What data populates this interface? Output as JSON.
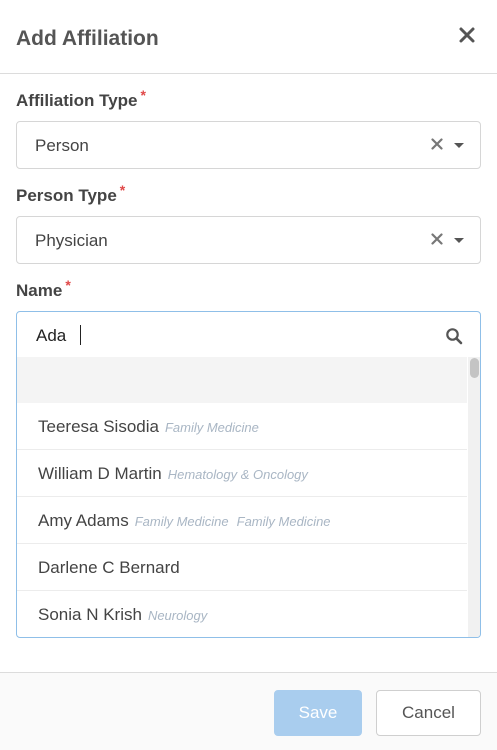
{
  "dialog": {
    "title": "Add Affiliation"
  },
  "fields": {
    "affiliation_type": {
      "label": "Affiliation Type",
      "required": "*",
      "value": "Person"
    },
    "person_type": {
      "label": "Person Type",
      "required": "*",
      "value": "Physician"
    },
    "name": {
      "label": "Name",
      "required": "*",
      "value": "Ada"
    }
  },
  "options": [
    {
      "name": "Teeresa Sisodia",
      "specialties": [
        "Family Medicine"
      ]
    },
    {
      "name": "William D Martin",
      "specialties": [
        "Hematology & Oncology"
      ]
    },
    {
      "name": "Amy Adams",
      "specialties": [
        "Family Medicine",
        "Family Medicine"
      ]
    },
    {
      "name": "Darlene C Bernard",
      "specialties": []
    },
    {
      "name": "Sonia N Krish",
      "specialties": [
        "Neurology"
      ]
    }
  ],
  "footer": {
    "save_label": "Save",
    "cancel_label": "Cancel"
  },
  "colors": {
    "accent": "#8fbfe8",
    "save_button": "#a9cdee",
    "required": "#e04848"
  },
  "icons": {
    "close": "close-icon",
    "clear": "clear-icon",
    "dropdown": "chevron-down-icon",
    "search": "search-icon"
  }
}
